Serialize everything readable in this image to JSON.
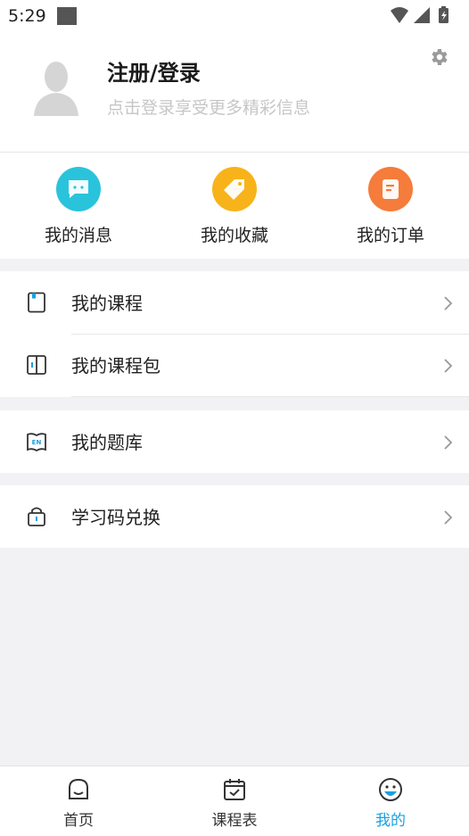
{
  "status_bar": {
    "time": "5:29"
  },
  "profile": {
    "title": "注册/登录",
    "subtitle": "点击登录享受更多精彩信息"
  },
  "quick_actions": [
    {
      "label": "我的消息",
      "icon": "message-icon",
      "color": "#2ac3dc"
    },
    {
      "label": "我的收藏",
      "icon": "tag-icon",
      "color": "#f7b319"
    },
    {
      "label": "我的订单",
      "icon": "order-icon",
      "color": "#f57c3a"
    }
  ],
  "menu_groups": [
    [
      {
        "label": "我的课程",
        "icon": "course-book-icon"
      },
      {
        "label": "我的课程包",
        "icon": "course-package-icon"
      }
    ],
    [
      {
        "label": "我的题库",
        "icon": "question-bank-icon"
      }
    ],
    [
      {
        "label": "学习码兑换",
        "icon": "redeem-code-icon"
      }
    ]
  ],
  "tabs": [
    {
      "label": "首页",
      "icon": "home-icon",
      "active": false
    },
    {
      "label": "课程表",
      "icon": "schedule-icon",
      "active": false
    },
    {
      "label": "我的",
      "icon": "profile-face-icon",
      "active": true
    }
  ],
  "colors": {
    "accent": "#1aa0e0",
    "background": "#f2f2f4"
  }
}
